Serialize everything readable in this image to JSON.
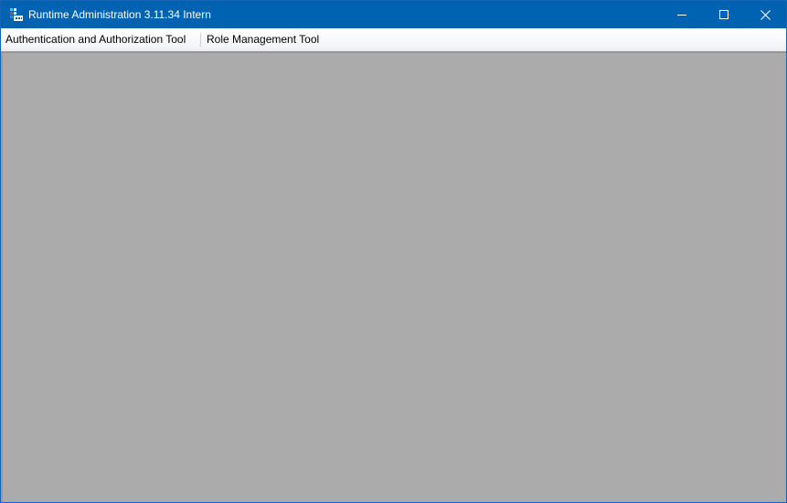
{
  "window": {
    "title": "Runtime Administration 3.11.34 Intern",
    "app_icon": "grid-app-icon",
    "controls": {
      "minimize_icon": "minimize-icon",
      "maximize_icon": "maximize-icon",
      "close_icon": "close-icon"
    }
  },
  "menubar": {
    "items": [
      {
        "label": "Authentication and Authorization Tool"
      },
      {
        "label": "Role Management Tool"
      }
    ]
  },
  "colors": {
    "titlebar": "#0063b1",
    "client_area": "#ababab",
    "title_text": "#ffffff"
  }
}
